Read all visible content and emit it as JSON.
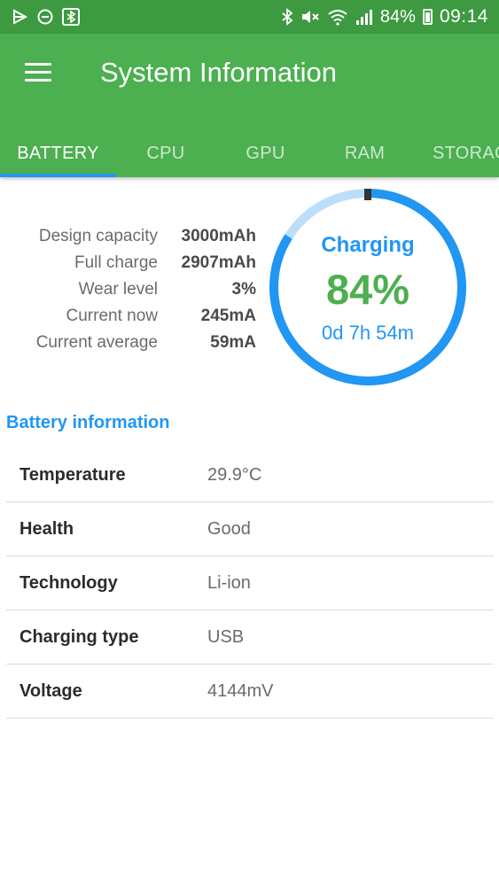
{
  "status_bar": {
    "left_icons": [
      "play-store-notification-icon",
      "do-not-disturb-icon",
      "bluetooth-notification-icon"
    ],
    "right_icons": [
      "bluetooth-icon",
      "mute-icon",
      "wifi-icon",
      "signal-icon",
      "battery-icon"
    ],
    "battery_percent": "84%",
    "time": "09:14"
  },
  "app_bar": {
    "title": "System Information",
    "tabs": [
      "BATTERY",
      "CPU",
      "GPU",
      "RAM",
      "STORAG"
    ],
    "active_tab": "BATTERY"
  },
  "summary": {
    "rows": [
      {
        "label": "Design capacity",
        "value": "3000mAh"
      },
      {
        "label": "Full charge",
        "value": "2907mAh"
      },
      {
        "label": "Wear level",
        "value": "3%"
      },
      {
        "label": "Current now",
        "value": "245mA"
      },
      {
        "label": "Current average",
        "value": "59mA"
      }
    ]
  },
  "ring": {
    "status": "Charging",
    "percent_text": "84%",
    "level_fraction": 0.84,
    "time_remaining": "0d 7h 54m",
    "fill_color": "#2196f3",
    "track_color": "#bbdefb"
  },
  "battery_info": {
    "header": "Battery information",
    "rows": [
      {
        "label": "Temperature",
        "value": "29.9°C"
      },
      {
        "label": "Health",
        "value": "Good"
      },
      {
        "label": "Technology",
        "value": "Li-ion"
      },
      {
        "label": "Charging type",
        "value": "USB"
      },
      {
        "label": "Voltage",
        "value": "4144mV"
      }
    ]
  },
  "colors": {
    "status_bar": "#3d9a41",
    "app_bar": "#4caf50",
    "accent": "#2196f3",
    "percent_green": "#4caf50"
  }
}
